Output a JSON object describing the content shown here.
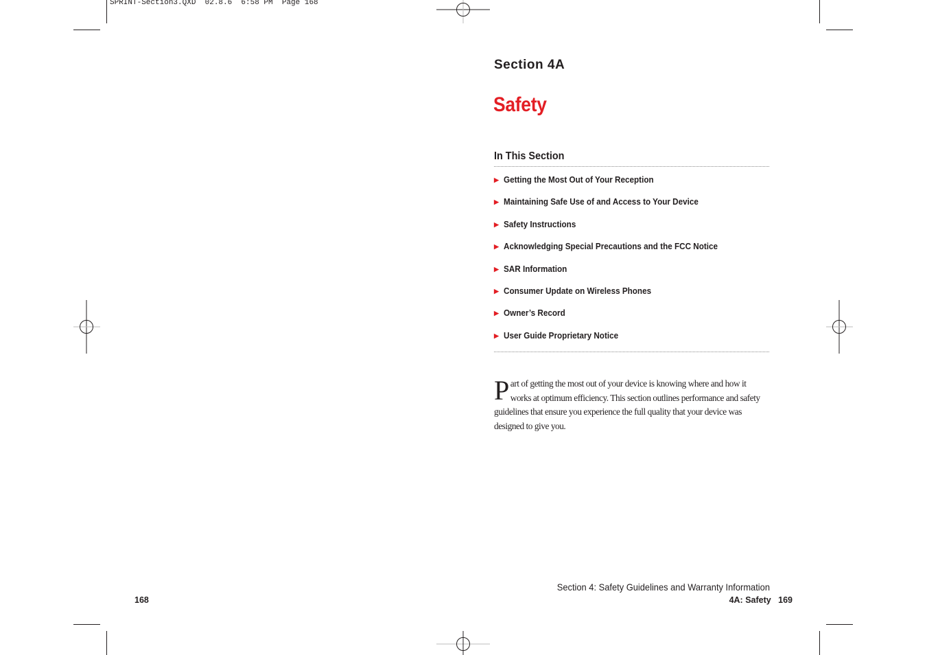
{
  "slug": "SPRINT-Section3.QXD  02.8.6  6:58 PM  Page 168",
  "header": {
    "section_label": "Section 4A",
    "title": "Safety",
    "accent_color": "#e31e24"
  },
  "in_this_section": {
    "heading": "In This Section",
    "items": [
      {
        "label": "Getting the Most Out of Your Reception"
      },
      {
        "label": "Maintaining Safe Use of and Access to Your Device"
      },
      {
        "label": "Safety Instructions"
      },
      {
        "label": "Acknowledging Special Precautions and the FCC Notice"
      },
      {
        "label": "SAR Information"
      },
      {
        "label": "Consumer Update on Wireless Phones"
      },
      {
        "label": "Owner’s Record"
      },
      {
        "label": "User Guide Proprietary Notice"
      }
    ],
    "bullet_icon": "red-triangle-right"
  },
  "intro": {
    "dropcap": "P",
    "text": "art of getting the most out of your device is knowing where and how it works at optimum efficiency. This section outlines performance and safety guidelines that ensure you experience the full quality that your device was designed to give you."
  },
  "footer": {
    "left_page_number": "168",
    "section_title": "Section 4: Safety Guidelines and Warranty Information",
    "right_label": "4A: Safety",
    "right_page_number": "169"
  }
}
